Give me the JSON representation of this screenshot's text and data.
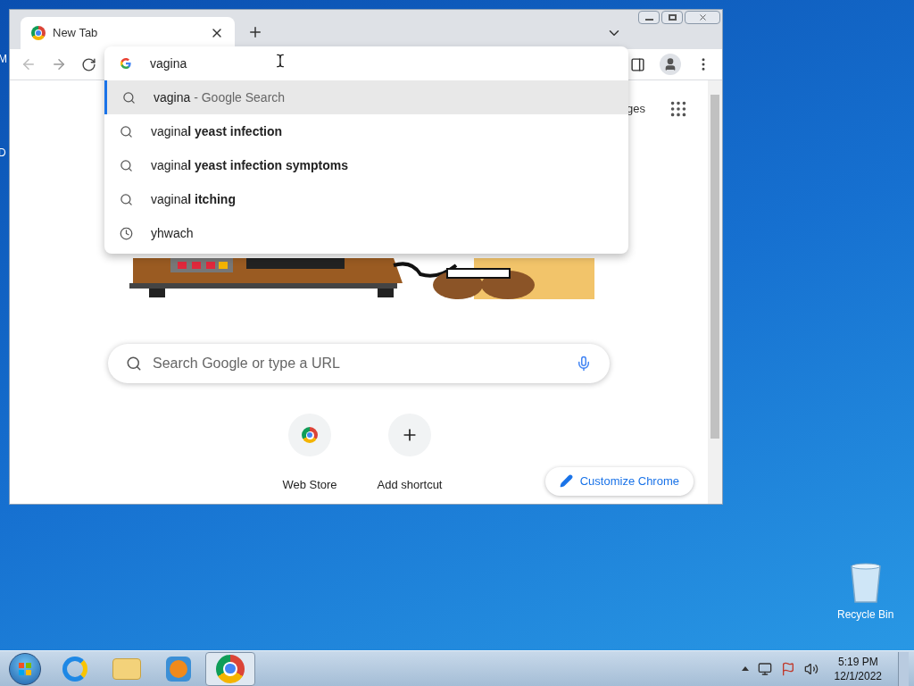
{
  "desktop": {
    "edge_labels": [
      "M",
      "D"
    ],
    "icons": [
      {
        "label": "Recycle Bin"
      }
    ]
  },
  "browser": {
    "tabs": [
      {
        "title": "New Tab",
        "selected": true
      }
    ],
    "omnibox": {
      "value": "vagina",
      "suggestions": [
        {
          "kind": "search",
          "text": "vagina",
          "suffix": "- Google Search",
          "selected": true
        },
        {
          "kind": "search",
          "text": "vagina**l yeast infection**",
          "selected": false
        },
        {
          "kind": "search",
          "text": "vagina**l yeast infection symptoms**",
          "selected": false
        },
        {
          "kind": "search",
          "text": "vagina**l itching**",
          "selected": false
        },
        {
          "kind": "history",
          "text": "yhwach",
          "selected": false
        }
      ]
    },
    "ntp": {
      "top_link": "ges",
      "search_placeholder": "Search Google or type a URL",
      "shortcuts": [
        {
          "kind": "webstore",
          "label": "Web Store"
        },
        {
          "kind": "add",
          "label": "Add shortcut"
        }
      ],
      "customize_button": "Customize Chrome"
    }
  },
  "taskbar": {
    "apps": [
      {
        "kind": "ie",
        "active": false
      },
      {
        "kind": "explorer",
        "active": false
      },
      {
        "kind": "media",
        "active": false
      },
      {
        "kind": "chrome",
        "active": true
      }
    ],
    "clock": {
      "time": "5:19 PM",
      "date": "12/1/2022"
    }
  }
}
